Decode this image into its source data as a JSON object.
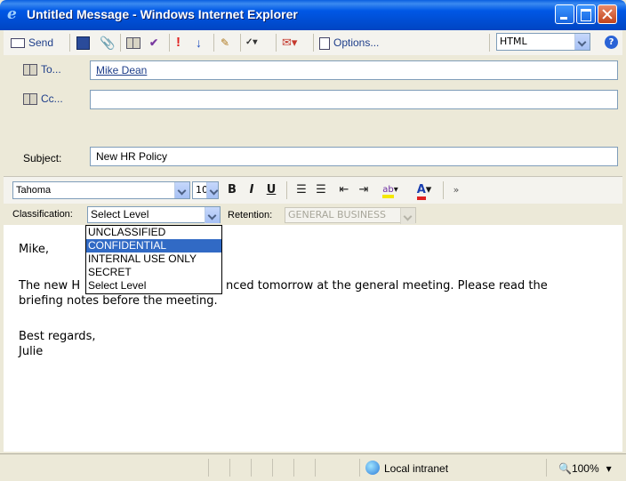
{
  "window": {
    "title": "Untitled Message - Windows Internet Explorer"
  },
  "toolbar": {
    "send_label": "Send",
    "options_label": "Options...",
    "format_value": "HTML"
  },
  "header": {
    "to_label": "To...",
    "to_value": "Mike Dean",
    "cc_label": "Cc...",
    "cc_value": "",
    "subject_label": "Subject:",
    "subject_value": "New HR Policy"
  },
  "format_bar": {
    "font_value": "Tahoma",
    "size_value": "10",
    "bold": "B",
    "italic": "I",
    "underline": "U"
  },
  "classification": {
    "label": "Classification:",
    "value": "Select Level",
    "options": [
      "UNCLASSIFIED",
      "CONFIDENTIAL",
      "INTERNAL USE ONLY",
      "SECRET",
      "Select Level"
    ],
    "highlighted_index": 1,
    "retention_label": "Retention:",
    "retention_value": "GENERAL BUSINESS"
  },
  "body": {
    "greeting": "Mike,",
    "line1_before": "The new H",
    "line1_after": "nced tomorrow at the general meeting. Please read the",
    "line2": "briefing notes before the meeting.",
    "closing": "Best regards,",
    "signature": "Julie"
  },
  "status": {
    "zone": "Local intranet",
    "zoom": "100%"
  },
  "colors": {
    "accent": "#316ac5",
    "titlebar": "#0058e6"
  }
}
